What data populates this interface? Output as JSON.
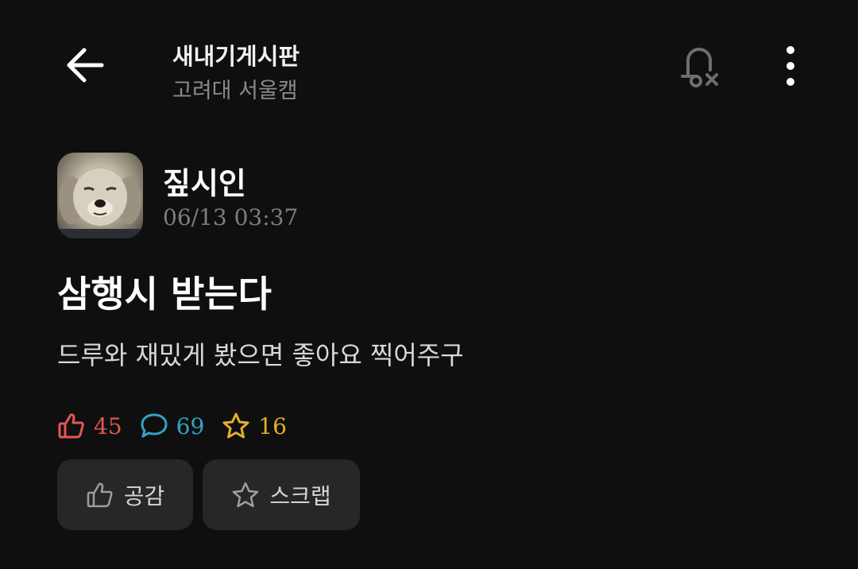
{
  "header": {
    "board_title": "새내기게시판",
    "board_subtitle": "고려대 서울캠",
    "icons": [
      "back-arrow-icon",
      "bell-off-icon",
      "more-vertical-icon"
    ]
  },
  "post": {
    "author": "짚시인",
    "timestamp": "06/13 03:37",
    "title": "삼행시 받는다",
    "body": "드루와 재밌게 봤으면 좋아요 찍어주구",
    "stats": {
      "likes": "45",
      "comments": "69",
      "scraps": "16"
    }
  },
  "actions": {
    "like_label": "공감",
    "scrap_label": "스크랩"
  },
  "colors": {
    "background": "#0f0f10",
    "like": "#e0584f",
    "comment": "#32a4c4",
    "scrap": "#e3b02a",
    "button_bg": "#272729"
  }
}
